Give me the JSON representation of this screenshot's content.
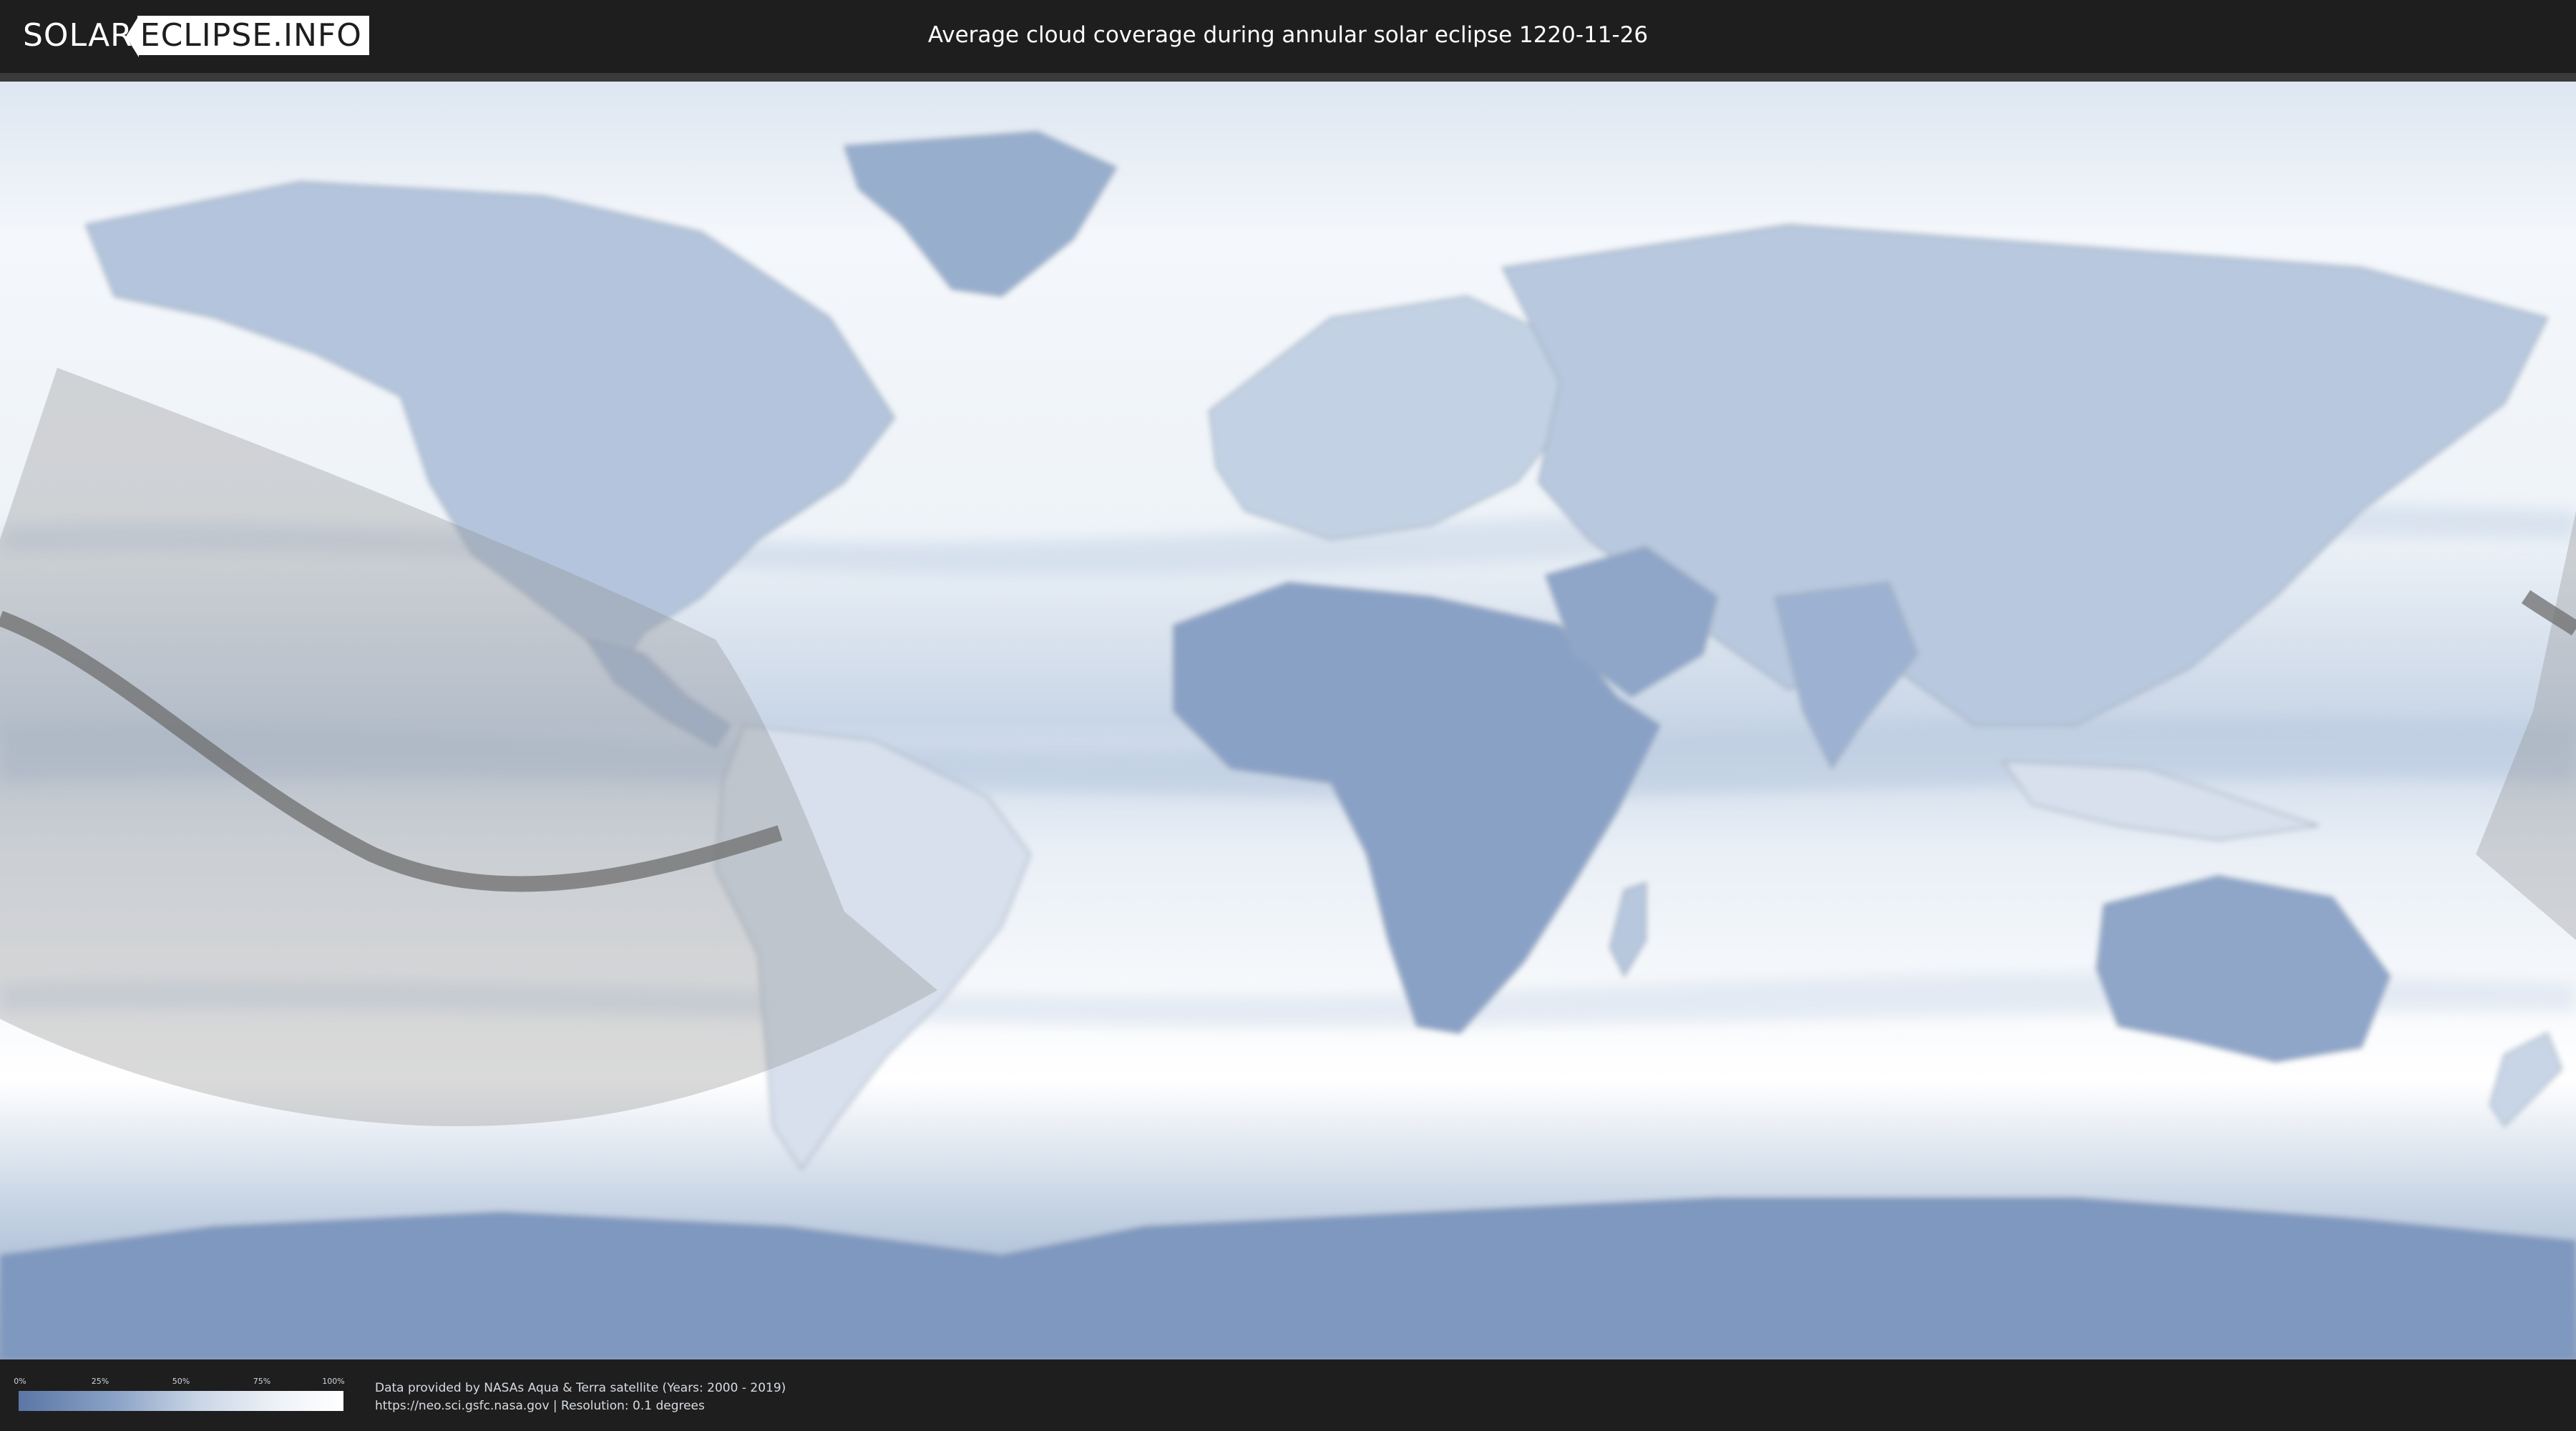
{
  "header": {
    "logo_left": "SOLAR",
    "logo_right": "ECLIPSE.INFO",
    "title": "Average cloud coverage during annular solar eclipse 1220-11-26"
  },
  "map": {
    "type": "world cloud coverage map (equirectangular projection)",
    "features": [
      "eclipse path of annularity (dark band)",
      "penumbra visibility zone (grey shaded area)"
    ],
    "colors": {
      "clear_sky": "#5b76a6",
      "cloudy": "#ffffff",
      "eclipse_zone": "#9a9a9a",
      "path_line": "#6e6e6e"
    }
  },
  "legend": {
    "ticks": [
      "0%",
      "25%",
      "50%",
      "75%",
      "100%"
    ],
    "gradient_start": "#5b76a6",
    "gradient_end": "#ffffff"
  },
  "credits": {
    "line1": "Data provided by NASAs Aqua & Terra satellite (Years: 2000 - 2019)",
    "line2": "https://neo.sci.gsfc.nasa.gov | Resolution: 0.1 degrees"
  }
}
